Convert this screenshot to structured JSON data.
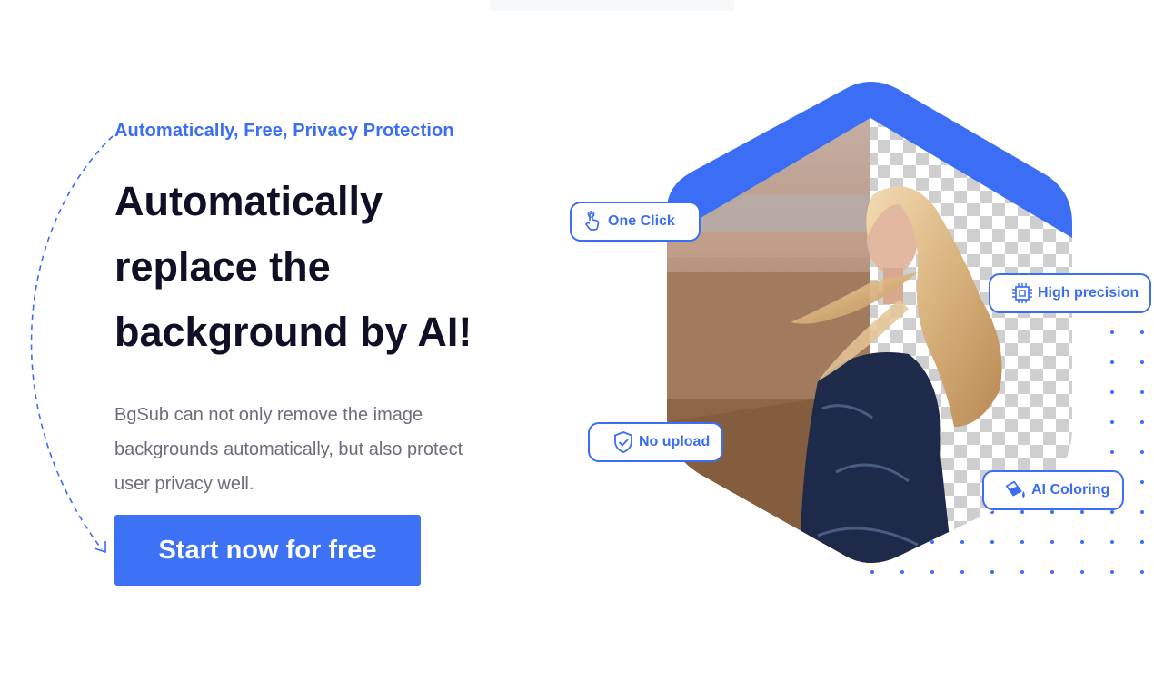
{
  "hero": {
    "tagline": "Automatically, Free, Privacy Protection",
    "headline": "Automatically replace the background by AI!",
    "description": "BgSub can not only remove the image backgrounds automatically, but also protect user privacy well.",
    "cta_label": "Start now for free"
  },
  "features": {
    "one_click": {
      "label": "One Click",
      "icon": "pointer-hand-icon"
    },
    "high_precision": {
      "label": "High precision",
      "icon": "chip-icon"
    },
    "no_upload": {
      "label": "No upload",
      "icon": "shield-check-icon"
    },
    "ai_coloring": {
      "label": "AI Coloring",
      "icon": "paint-bucket-icon"
    }
  },
  "colors": {
    "accent": "#3b6ef5",
    "headline": "#0f1026",
    "body_text": "#6b6e78",
    "button_bg": "#3d72f6"
  }
}
